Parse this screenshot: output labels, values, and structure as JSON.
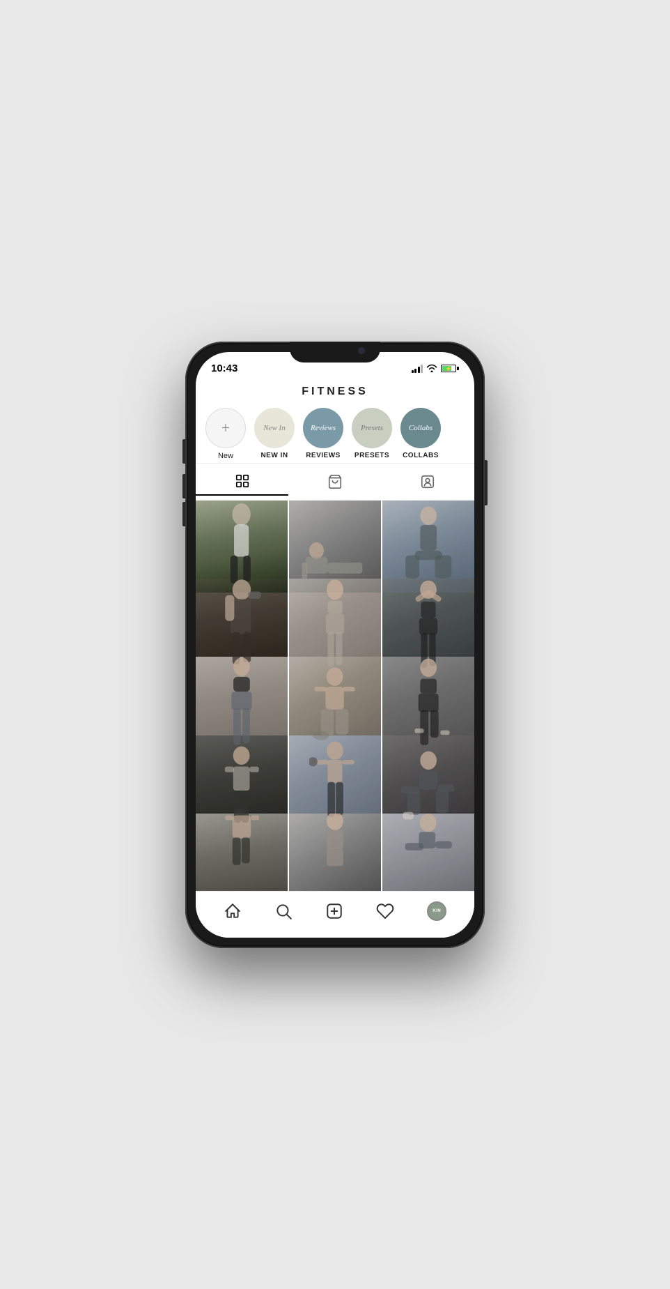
{
  "phone": {
    "status_bar": {
      "time": "10:43",
      "battery_color": "#4cd964"
    },
    "header": {
      "title": "FITNESS"
    },
    "stories": [
      {
        "id": "new",
        "label": "New",
        "label_style": "new",
        "circle_style": "new",
        "text": "+"
      },
      {
        "id": "new-in",
        "label": "NEW IN",
        "circle_style": "new-in",
        "text": "New In"
      },
      {
        "id": "reviews",
        "label": "REVIEWS",
        "circle_style": "reviews",
        "text": "Reviews"
      },
      {
        "id": "presets",
        "label": "PRESETS",
        "circle_style": "presets",
        "text": "Presets"
      },
      {
        "id": "collabs",
        "label": "COLLABS",
        "circle_style": "collabs",
        "text": "Collabs"
      }
    ],
    "view_tabs": [
      {
        "id": "grid",
        "label": "Grid view",
        "active": true
      },
      {
        "id": "shop",
        "label": "Shop view",
        "active": false
      },
      {
        "id": "tag",
        "label": "Tag view",
        "active": false
      }
    ],
    "grid_photos": [
      {
        "id": 1,
        "alt": "Woman jogging with earphones outdoors"
      },
      {
        "id": 2,
        "alt": "Man doing pushup exercise"
      },
      {
        "id": 3,
        "alt": "Woman doing yoga stretch"
      },
      {
        "id": 4,
        "alt": "Muscular man with dumbbell"
      },
      {
        "id": 5,
        "alt": "Woman in sports bra posing"
      },
      {
        "id": 6,
        "alt": "Fit woman posing with hands behind head"
      },
      {
        "id": 7,
        "alt": "Woman in Nike sports bra"
      },
      {
        "id": 8,
        "alt": "Athletic man sitting on rocks"
      },
      {
        "id": 9,
        "alt": "Woman doing lunge exercise"
      },
      {
        "id": 10,
        "alt": "Man with kettlebell"
      },
      {
        "id": 11,
        "alt": "Man exercising with dumbbell"
      },
      {
        "id": 12,
        "alt": "Woman sitting stretch"
      },
      {
        "id": 13,
        "alt": "Man side stretch partial"
      },
      {
        "id": 14,
        "alt": "Woman partial pose"
      },
      {
        "id": 15,
        "alt": "Woman seated partial"
      }
    ],
    "bottom_nav": [
      {
        "id": "home",
        "label": "Home",
        "icon": "home-icon"
      },
      {
        "id": "search",
        "label": "Search",
        "icon": "search-icon"
      },
      {
        "id": "add",
        "label": "Add",
        "icon": "add-icon"
      },
      {
        "id": "heart",
        "label": "Likes",
        "icon": "heart-icon"
      },
      {
        "id": "profile",
        "label": "Profile",
        "icon": "profile-icon"
      }
    ]
  }
}
